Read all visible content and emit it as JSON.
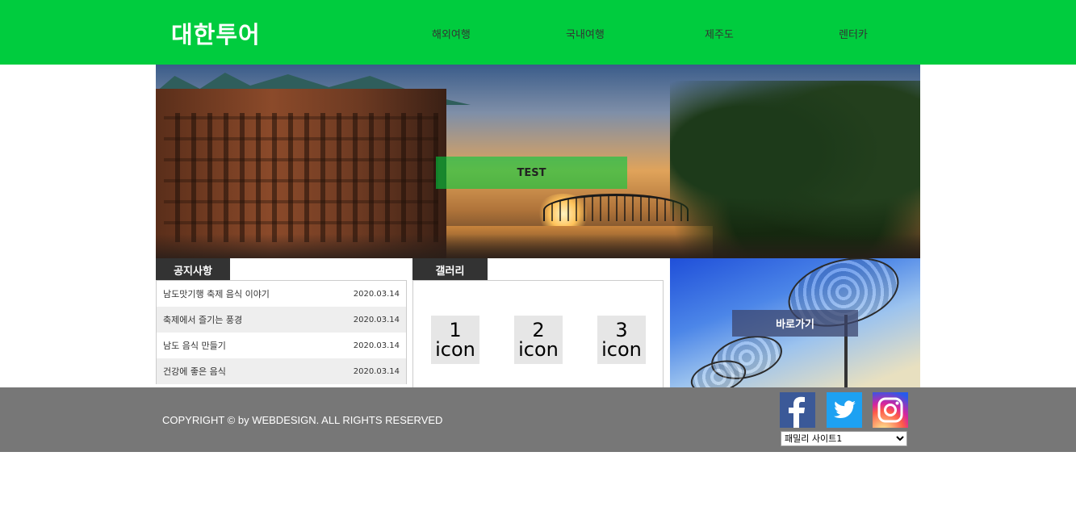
{
  "header": {
    "logo": "대한투어",
    "nav": [
      "해외여행",
      "국내여행",
      "제주도",
      "렌터카"
    ]
  },
  "hero": {
    "button_label": "TEST"
  },
  "notice": {
    "title": "공지사항",
    "items": [
      {
        "title": "남도맛기행 축제 음식 이야기",
        "date": "2020.03.14"
      },
      {
        "title": "축제에서 즐기는 풍경",
        "date": "2020.03.14"
      },
      {
        "title": "남도 음식 만들기",
        "date": "2020.03.14"
      },
      {
        "title": "건강에 좋은 음식",
        "date": "2020.03.14"
      }
    ]
  },
  "gallery": {
    "title": "갤러리",
    "icons": [
      {
        "number": "1",
        "word": "icon"
      },
      {
        "number": "2",
        "word": "icon"
      },
      {
        "number": "3",
        "word": "icon"
      }
    ]
  },
  "banner": {
    "button_label": "바로가기"
  },
  "footer": {
    "copyright": "COPYRIGHT © by WEBDESIGN. ALL RIGHTS RESERVED",
    "family_site_selected": "패밀리 사이트1",
    "social_icons": [
      "facebook-icon",
      "twitter-icon",
      "instagram-icon"
    ]
  },
  "colors": {
    "brand_green": "#00cc3e",
    "footer_gray": "#777777",
    "tab_dark": "#333333"
  }
}
